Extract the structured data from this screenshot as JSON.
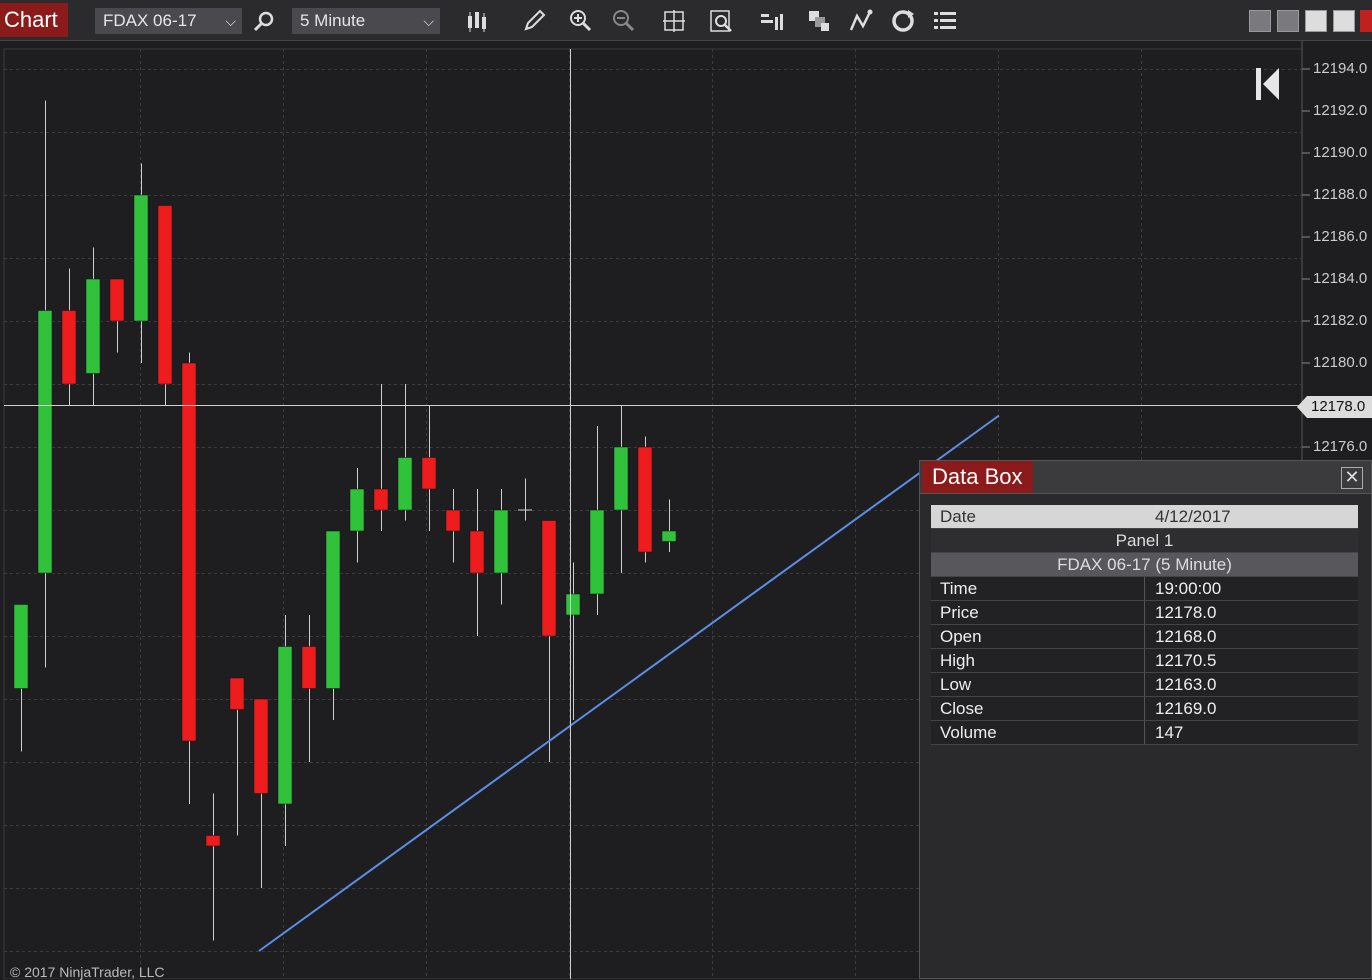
{
  "toolbar": {
    "tab_label": "Chart",
    "instrument": "FDAX 06-17",
    "interval": "5 Minute",
    "icons": [
      "search-icon",
      "bar-type-icon",
      "drawing-pencil-icon",
      "zoom-in-icon",
      "zoom-out-icon",
      "crosshair-icon",
      "data-search-icon",
      "chart-style-icon",
      "layers-icon",
      "indicator-icon",
      "refresh-icon",
      "list-icon"
    ]
  },
  "price_axis": {
    "labels": [
      "12194.0",
      "12192.0",
      "12190.0",
      "12188.0",
      "12186.0",
      "12184.0",
      "12182.0",
      "12180.0",
      "12178.0",
      "12176.0"
    ],
    "current_price": "12178.0"
  },
  "copyright": "© 2017 NinjaTrader, LLC",
  "colors": {
    "up": "#2fc23a",
    "down": "#ee1c1c",
    "trendline": "#5b8ee6",
    "brand": "#8b1b1b"
  },
  "chart_data": {
    "type": "candlestick",
    "instrument": "FDAX 06-17",
    "interval": "5 Minute",
    "ylim": [
      12157.5,
      12195.5
    ],
    "candles": [
      {
        "o": 12164.5,
        "h": 12166.0,
        "l": 12161.5,
        "c": 12168.5
      },
      {
        "o": 12170.0,
        "h": 12192.5,
        "l": 12165.5,
        "c": 12182.5
      },
      {
        "o": 12182.5,
        "h": 12184.5,
        "l": 12178.0,
        "c": 12179.0
      },
      {
        "o": 12179.5,
        "h": 12185.5,
        "l": 12178.0,
        "c": 12184.0
      },
      {
        "o": 12184.0,
        "h": 12182.5,
        "l": 12180.5,
        "c": 12182.0
      },
      {
        "o": 12182.0,
        "h": 12189.5,
        "l": 12180.0,
        "c": 12188.0
      },
      {
        "o": 12187.5,
        "h": 12187.5,
        "l": 12178.0,
        "c": 12179.0
      },
      {
        "o": 12180.0,
        "h": 12180.5,
        "l": 12159.0,
        "c": 12162.0
      },
      {
        "o": 12157.5,
        "h": 12159.5,
        "l": 12152.5,
        "c": 12157.0
      },
      {
        "o": 12165.0,
        "h": 12163.5,
        "l": 12157.5,
        "c": 12163.5
      },
      {
        "o": 12164.0,
        "h": 12162.5,
        "l": 12155.0,
        "c": 12159.5
      },
      {
        "o": 12159.0,
        "h": 12168.0,
        "l": 12157.0,
        "c": 12166.5
      },
      {
        "o": 12166.5,
        "h": 12168.0,
        "l": 12161.0,
        "c": 12164.5
      },
      {
        "o": 12164.5,
        "h": 12171.5,
        "l": 12163.0,
        "c": 12172.0
      },
      {
        "o": 12172.0,
        "h": 12175.0,
        "l": 12170.5,
        "c": 12174.0
      },
      {
        "o": 12174.0,
        "h": 12179.0,
        "l": 12172.0,
        "c": 12173.0
      },
      {
        "o": 12173.0,
        "h": 12179.0,
        "l": 12172.5,
        "c": 12175.5
      },
      {
        "o": 12175.5,
        "h": 12178.0,
        "l": 12172.0,
        "c": 12174.0
      },
      {
        "o": 12173.0,
        "h": 12174.0,
        "l": 12170.5,
        "c": 12172.0
      },
      {
        "o": 12172.0,
        "h": 12174.0,
        "l": 12167.0,
        "c": 12170.0
      },
      {
        "o": 12170.0,
        "h": 12174.0,
        "l": 12168.5,
        "c": 12173.0
      },
      {
        "o": 12173.0,
        "h": 12174.5,
        "l": 12172.5,
        "c": 12173.0
      },
      {
        "o": 12172.5,
        "h": 12168.0,
        "l": 12161.0,
        "c": 12167.0
      },
      {
        "o": 12168.0,
        "h": 12170.5,
        "l": 12163.0,
        "c": 12169.0
      },
      {
        "o": 12169.0,
        "h": 12177.0,
        "l": 12168.0,
        "c": 12173.0
      },
      {
        "o": 12173.0,
        "h": 12178.0,
        "l": 12170.0,
        "c": 12176.0
      },
      {
        "o": 12176.0,
        "h": 12176.5,
        "l": 12170.5,
        "c": 12171.0
      },
      {
        "o": 12171.5,
        "h": 12173.5,
        "l": 12171.0,
        "c": 12172.0
      }
    ],
    "crosshair_price": 12178.0,
    "trendline": {
      "from_price": 12152.0,
      "to_price": 12177.5
    }
  },
  "data_box": {
    "title": "Data Box",
    "date_label": "Date",
    "date_value": "4/12/2017",
    "panel": "Panel 1",
    "series": "FDAX 06-17 (5 Minute)",
    "rows": [
      {
        "key": "Time",
        "value": "19:00:00"
      },
      {
        "key": "Price",
        "value": "12178.0"
      },
      {
        "key": "Open",
        "value": "12168.0"
      },
      {
        "key": "High",
        "value": "12170.5"
      },
      {
        "key": "Low",
        "value": "12163.0"
      },
      {
        "key": "Close",
        "value": "12169.0"
      },
      {
        "key": "Volume",
        "value": "147"
      }
    ]
  }
}
